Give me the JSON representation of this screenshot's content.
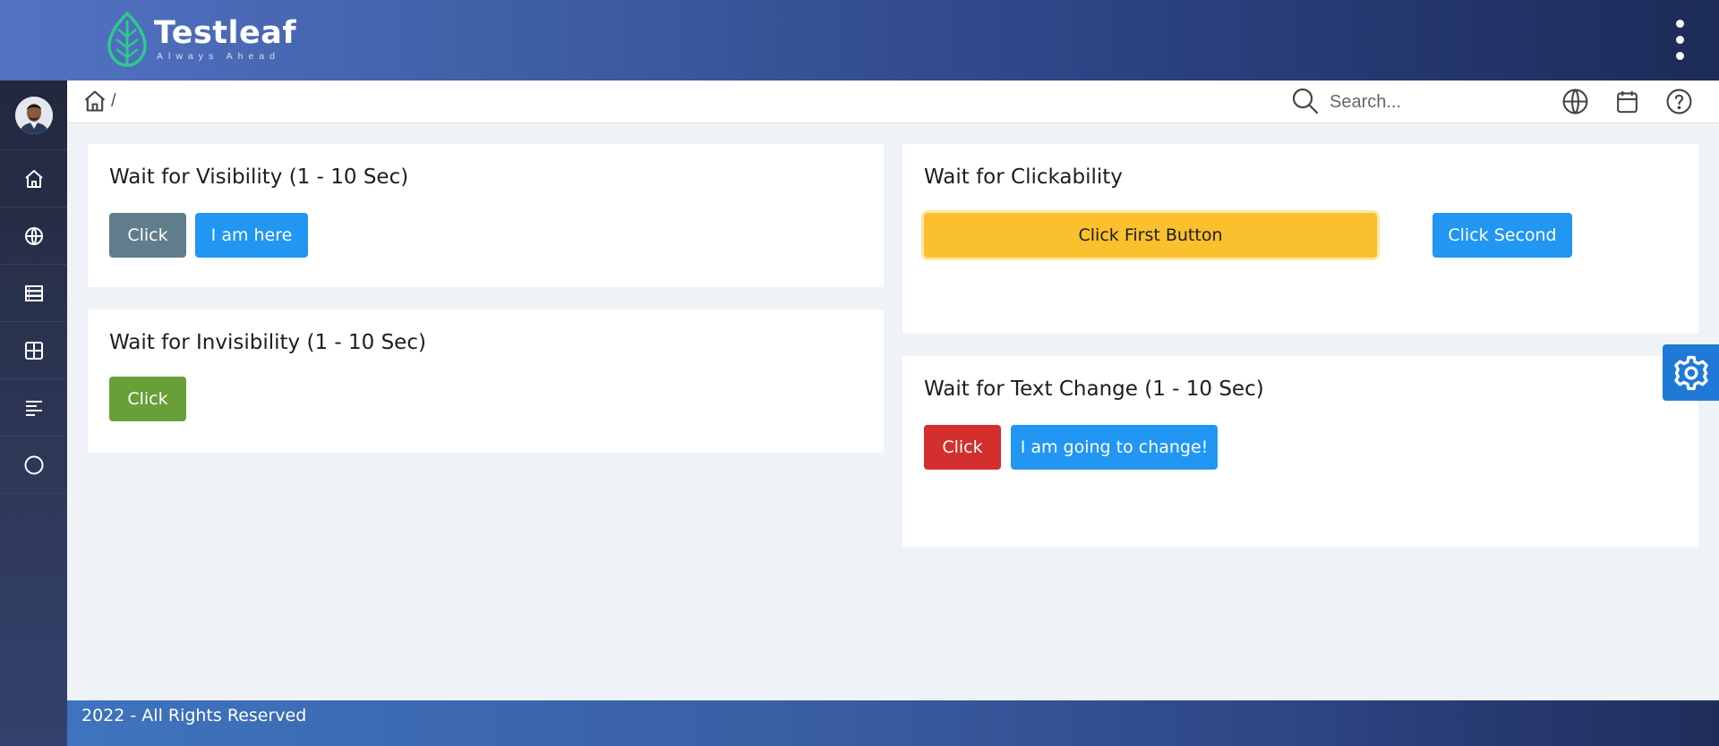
{
  "header": {
    "logo_name": "Testleaf",
    "logo_tagline": "Always Ahead",
    "menu_icon": "more-vertical-icon"
  },
  "sidebar": {
    "items": [
      {
        "icon": "home-icon"
      },
      {
        "icon": "globe-icon"
      },
      {
        "icon": "server-icon"
      },
      {
        "icon": "grid-icon"
      },
      {
        "icon": "align-left-icon"
      },
      {
        "icon": "circle-icon"
      }
    ]
  },
  "toolbar": {
    "breadcrumb_separator": "/",
    "search_placeholder": "Search...",
    "icons": [
      "search-icon",
      "globe-icon",
      "calendar-icon",
      "help-icon"
    ]
  },
  "cards": {
    "visibility": {
      "title": "Wait for Visibility (1 - 10 Sec)",
      "click_label": "Click",
      "target_label": "I am here"
    },
    "invisibility": {
      "title": "Wait for Invisibility (1 - 10 Sec)",
      "click_label": "Click"
    },
    "clickability": {
      "title": "Wait for Clickability",
      "first_label": "Click First Button",
      "second_label": "Click Second"
    },
    "text_change": {
      "title": "Wait for Text Change (1 - 10 Sec)",
      "click_label": "Click",
      "target_label": "I am going to change!"
    }
  },
  "colors": {
    "gray_button": "#607d8b",
    "blue_button": "#2196f3",
    "green_button": "#689f38",
    "amber_button": "#fbc02d",
    "red_button": "#d32f2f",
    "settings_tab": "#1e7ad6"
  },
  "footer": {
    "text": "2022 - All Rights Reserved"
  }
}
